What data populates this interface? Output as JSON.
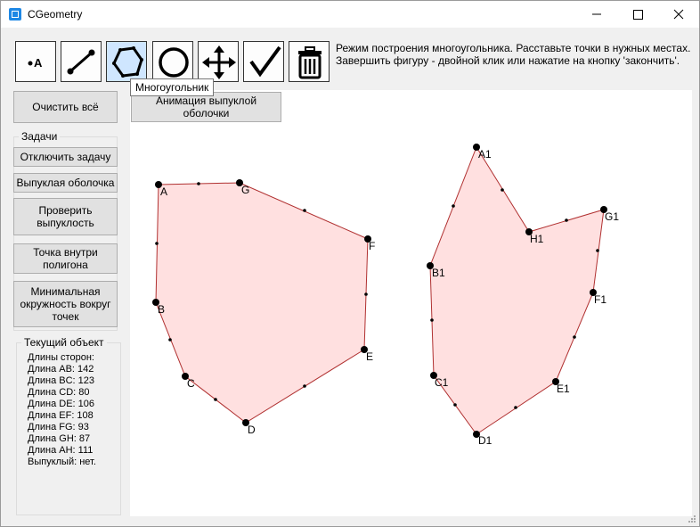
{
  "window": {
    "title": "CGeometry"
  },
  "toolbar": {
    "tooltip": "Многоугольник",
    "hint": "Режим построения многоугольника. Расставьте точки в нужных местах. Завершить фигуру - двойной клик или нажатие на кнопку 'закончить'.",
    "tools": [
      {
        "name": "point-tool",
        "icon": "point-a-icon",
        "label": "A"
      },
      {
        "name": "segment-tool",
        "icon": "segment-icon"
      },
      {
        "name": "polygon-tool",
        "icon": "polygon-icon",
        "active": true
      },
      {
        "name": "circle-tool",
        "icon": "circle-icon"
      },
      {
        "name": "move-tool",
        "icon": "move-arrows-icon"
      },
      {
        "name": "finish-tool",
        "icon": "checkmark-icon"
      },
      {
        "name": "delete-tool",
        "icon": "trash-icon"
      }
    ]
  },
  "sidebar": {
    "clear_all": "Очистить всё",
    "tasks_title": "Задачи",
    "disable_task": "Отключить задачу",
    "convex_hull": "Выпуклая оболочка",
    "check_convex": "Проверить выпуклость",
    "point_inside": "Точка внутри полигона",
    "min_circle": "Минимальная окружность вокруг точек",
    "current_title": "Текущий объект",
    "info_lines": [
      "Длины сторон:",
      "Длина AB: 142",
      "Длина BC: 123",
      "Длина CD: 80",
      "Длина DE: 106",
      "Длина EF: 108",
      "Длина FG: 93",
      "Длина GH: 87",
      "Длина AH: 111",
      "Выпуклый: нет."
    ]
  },
  "canvas": {
    "animation_button": "Анимация выпуклой оболочки",
    "fill_color": "#ffe0e0",
    "stroke_color": "#b03030",
    "polygon1_labels": [
      "A",
      "G",
      "F",
      "E",
      "D",
      "C",
      "B"
    ],
    "polygon2_labels": [
      "A1",
      "H1",
      "G1",
      "F1",
      "E1",
      "D1",
      "C1",
      "B1"
    ]
  }
}
